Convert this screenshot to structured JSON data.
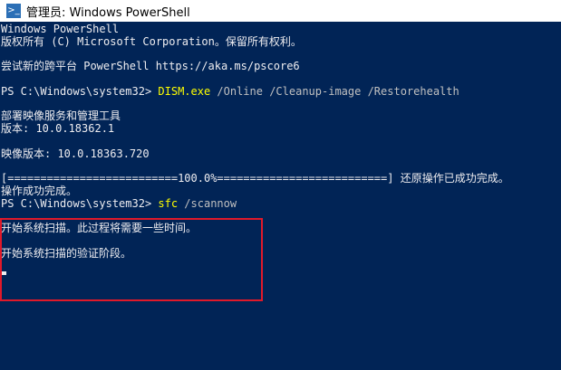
{
  "window": {
    "title": "管理员: Windows PowerShell",
    "icon": "powershell-icon"
  },
  "console": {
    "header_1": "Windows PowerShell",
    "header_2": "版权所有 (C) Microsoft Corporation。保留所有权利。",
    "tip": "尝试新的跨平台 PowerShell https://aka.ms/pscore6",
    "prompt": "PS C:\\Windows\\system32> ",
    "cmd1_name": "DISM.exe",
    "cmd1_args": " /Online /Cleanup-image /Restorehealth",
    "dism_tool": "部署映像服务和管理工具",
    "dism_version": "版本: 10.0.18362.1",
    "image_version": "映像版本: 10.0.18363.720",
    "progress_text": "[==========================100.0%==========================] 还原操作已成功完成。",
    "op_done": "操作成功完成。",
    "cmd2_name": "sfc",
    "cmd2_args": " /scannow",
    "sfc_line1": "开始系统扫描。此过程将需要一些时间。",
    "sfc_line2": "开始系统扫描的验证阶段。"
  },
  "colors": {
    "background": "#012456",
    "text": "#eeedf0",
    "command": "#ffff00",
    "highlight": "#e0192a"
  }
}
